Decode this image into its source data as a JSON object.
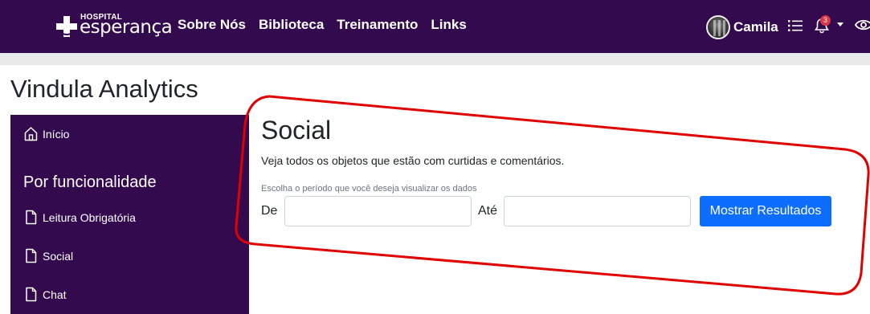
{
  "header": {
    "logo_small": "HOSPITAL",
    "logo_big": "esperança",
    "nav": [
      "Sobre Nós",
      "Biblioteca",
      "Treinamento",
      "Links"
    ],
    "user_name": "Camila",
    "notification_count": "3",
    "icons": [
      "cross-logo-icon",
      "list-icon",
      "bell-icon",
      "caret-down-icon",
      "eye-icon"
    ]
  },
  "page_title": "Vindula Analytics",
  "sidebar": {
    "home_label": "Início",
    "section_heading": "Por funcionalidade",
    "items": [
      "Leitura Obrigatória",
      "Social",
      "Chat"
    ]
  },
  "main": {
    "title": "Social",
    "description": "Veja todos os objetos que estão com curtidas e comentários.",
    "period_hint": "Escolha o período que você deseja visualizar os dados",
    "from_label": "De",
    "to_label": "Até",
    "from_value": "",
    "to_value": "",
    "submit_label": "Mostrar Resultados"
  },
  "colors": {
    "header_bg": "#330a4e",
    "sidebar_bg": "#330a4e",
    "primary_button": "#0d6efd",
    "badge": "#dc3545",
    "annotation": "#e00000"
  }
}
